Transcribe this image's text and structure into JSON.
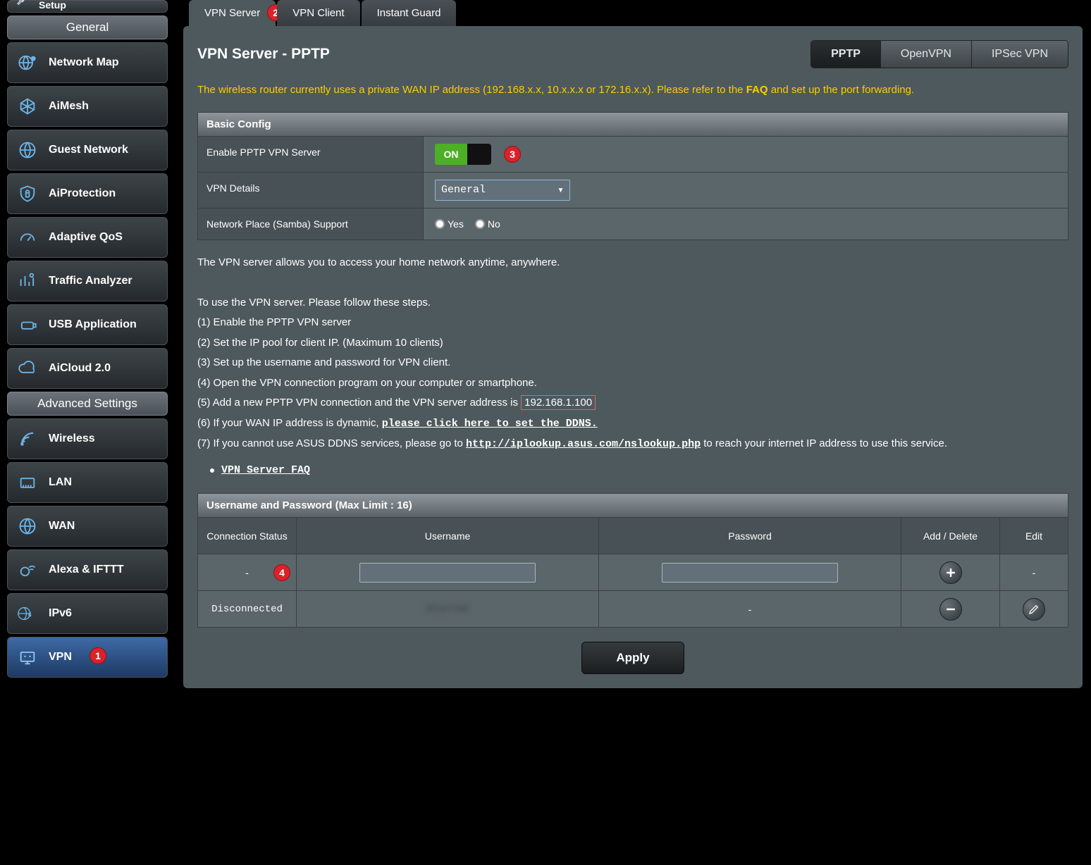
{
  "sidebar": {
    "top_item": "Setup",
    "general_header": "General",
    "general_items": [
      {
        "label": "Network Map"
      },
      {
        "label": "AiMesh"
      },
      {
        "label": "Guest Network"
      },
      {
        "label": "AiProtection"
      },
      {
        "label": "Adaptive QoS"
      },
      {
        "label": "Traffic Analyzer"
      },
      {
        "label": "USB Application"
      },
      {
        "label": "AiCloud 2.0"
      }
    ],
    "advanced_header": "Advanced Settings",
    "advanced_items": [
      {
        "label": "Wireless"
      },
      {
        "label": "LAN"
      },
      {
        "label": "WAN"
      },
      {
        "label": "Alexa & IFTTT"
      },
      {
        "label": "IPv6"
      },
      {
        "label": "VPN",
        "active": true
      }
    ]
  },
  "tabs": [
    {
      "label": "VPN Server",
      "active": true
    },
    {
      "label": "VPN Client"
    },
    {
      "label": "Instant Guard"
    }
  ],
  "badges": {
    "1": "1",
    "2": "2",
    "3": "3",
    "4": "4"
  },
  "page_title": "VPN Server - PPTP",
  "seg_buttons": [
    {
      "label": "PPTP",
      "active": true
    },
    {
      "label": "OpenVPN"
    },
    {
      "label": "IPSec VPN"
    }
  ],
  "warning_text_pre": "The wireless router currently uses a private WAN IP address (192.168.x.x, 10.x.x.x or 172.16.x.x). Please refer to the ",
  "warning_link": "FAQ",
  "warning_text_post": " and set up the port forwarding.",
  "basic_config_header": "Basic Config",
  "config": {
    "enable_label": "Enable PPTP VPN Server",
    "enable_state": "ON",
    "details_label": "VPN Details",
    "details_value": "General",
    "samba_label": "Network Place (Samba) Support",
    "samba_yes": "Yes",
    "samba_no": "No"
  },
  "desc": {
    "intro": "The VPN server allows you to access your home network anytime, anywhere.",
    "steps_intro": "To use the VPN server. Please follow these steps.",
    "s1": "(1) Enable the PPTP VPN server",
    "s2": "(2) Set the IP pool for client IP. (Maximum 10 clients)",
    "s3": "(3) Set up the username and password for VPN client.",
    "s4": "(4) Open the VPN connection program on your computer or smartphone.",
    "s5a": "(5) Add a new PPTP VPN connection and the VPN server address is",
    "s5b": "192.168.1.100",
    "s6a": "(6) If your WAN IP address is dynamic, ",
    "s6b": "please click here to set the DDNS.",
    "s7a": "(7) If you cannot use ASUS DDNS services, please go to ",
    "s7b": "http://iplookup.asus.com/nslookup.php",
    "s7c": " to reach your internet IP address to use this service.",
    "faq_link": "VPN Server FAQ"
  },
  "userpass": {
    "header": "Username and Password (Max Limit : 16)",
    "col_status": "Connection Status",
    "col_user": "Username",
    "col_pass": "Password",
    "col_action": "Add / Delete",
    "col_edit": "Edit",
    "row1": {
      "status": "-",
      "user": "",
      "pass": "",
      "edit": "-"
    },
    "row2": {
      "status": "Disconnected",
      "user": "blurred",
      "pass": "-"
    }
  },
  "apply_label": "Apply"
}
